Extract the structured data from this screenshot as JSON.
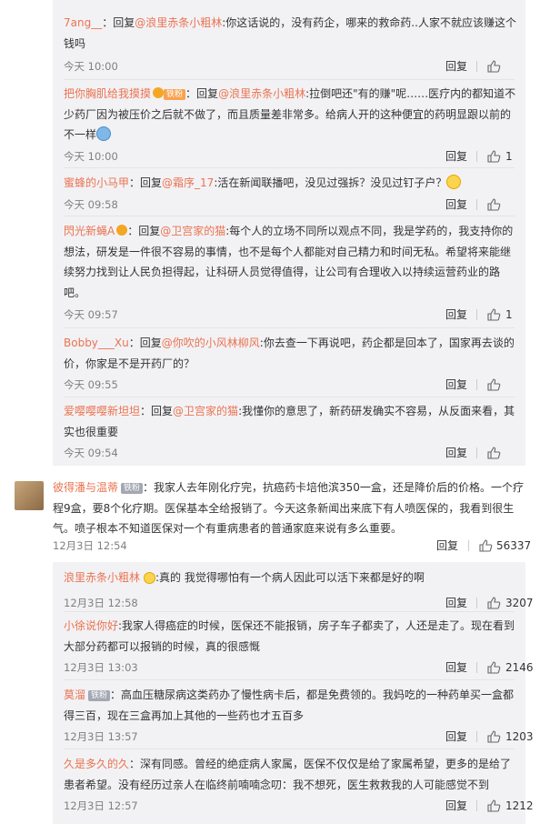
{
  "ui": {
    "reply": "回复",
    "reply_word": "回复"
  },
  "sub1": [
    {
      "user": "7ang__",
      "target": "@浪里赤条小粗林",
      "content": ":你这话说的，没有药企，哪来的救命药..人家不就应该赚这个钱吗",
      "time": "今天 10:00",
      "likes": ""
    },
    {
      "user": "把你胸肌给我摸摸",
      "badge": "铁粉",
      "target": "@浪里赤条小粗林",
      "content": ":拉倒吧还\"有的赚\"呢……医疗内的都知道不少药厂因为被压价之后就不做了，而且质量差非常多。给病人开的这种便宜的药明显跟以前的不一样",
      "time": "今天 10:00",
      "likes": "1"
    },
    {
      "user": "蜜蜂的小马甲",
      "target": "@霜序_17",
      "content": ":活在新闻联播吧，没见过强拆？没见过钉子户？",
      "time": "今天 09:58",
      "likes": ""
    },
    {
      "user": "閃光新蝇A",
      "target": "@卫宫家的猫",
      "content": ":每个人的立场不同所以观点不同，我是学药的，我支持你的想法，研发是一件很不容易的事情，也不是每个人都能对自己精力和时间无私。希望将来能继续努力找到让人民负担得起，让科研人员觉得值得，让公司有合理收入以持续运营药业的路吧。",
      "time": "今天 09:57",
      "likes": "1"
    },
    {
      "user": "Bobby___Xu",
      "target": "@你吹的小风林柳风",
      "content": ":你去查一下再说吧，药企都是回本了，国家再去谈的价，你家是不是开药厂的？",
      "time": "今天 09:55",
      "likes": ""
    },
    {
      "user": "爱嘤嘤嘤新坦坦",
      "target": "@卫宫家的猫",
      "content": ":我懂你的意思了，新药研发确实不容易，从反面来看，其实也很重要",
      "time": "今天 09:54",
      "likes": ""
    }
  ],
  "main_comment": {
    "user": "彼得潘与温蒂",
    "badge": "铁粉",
    "content": "：我家人去年刚化疗完，抗癌药卡培他滨350一盒，还是降价后的价格。一个疗程9盒，要8个化疗期。医保基本全给报销了。今天这条新闻出来底下有人喷医保的，我看到很生气。喷子根本不知道医保对一个有重病患者的普通家庭来说有多么重要。",
    "time": "12月3日 12:54",
    "likes": "56337"
  },
  "sub2": [
    {
      "user": "浪里赤条小粗林",
      "content": ":真的 我觉得哪怕有一个病人因此可以活下来都是好的啊",
      "time": "12月3日 12:58",
      "likes": "3207"
    },
    {
      "user": "小徐说你好",
      "content": ":我家人得癌症的时候，医保还不能报销，房子车子都卖了，人还是走了。现在看到大部分药都可以报销的时候，真的很感慨",
      "time": "12月3日 13:03",
      "likes": "2146"
    },
    {
      "user": "莫溜",
      "badge": "铁粉",
      "content": "：高血压糖尿病这类药办了慢性病卡后，都是免费领的。我妈吃的一种药单买一盒都得三百，现在三盒再加上其他的一些药也才五百多",
      "time": "12月3日 13:57",
      "likes": "1203"
    },
    {
      "user": "久是多久的久",
      "content": "：深有同感。曾经的绝症病人家属，医保不仅仅是给了家属希望，更多的是给了患者希望。没有经历过亲人在临终前喃喃念叨：我不想死，医生救救我的人可能感觉不到",
      "time": "12月3日 12:57",
      "likes": "1212"
    }
  ]
}
